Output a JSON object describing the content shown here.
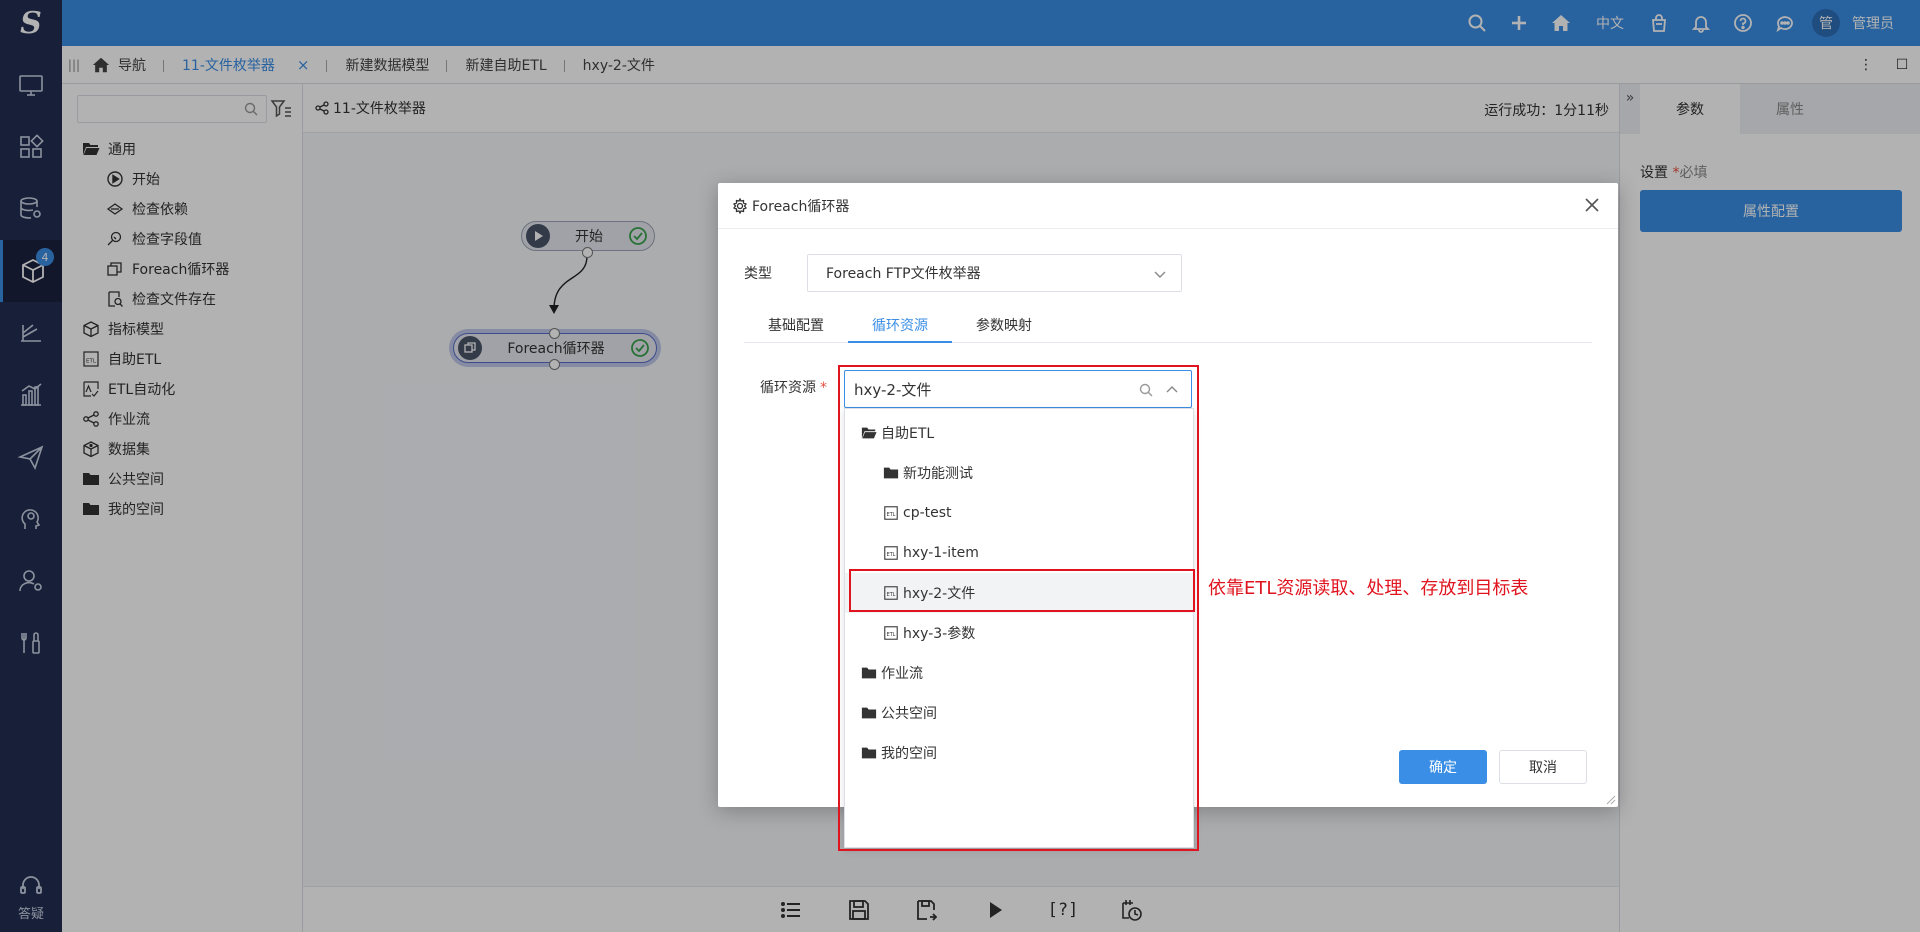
{
  "header": {
    "logo": "S",
    "lang": "中文",
    "avatar": "管",
    "user": "管理员"
  },
  "nav": {
    "badge": "4",
    "help_label": "答疑"
  },
  "tabs": [
    {
      "label": "导航"
    },
    {
      "label": "11-文件枚举器",
      "active": true
    },
    {
      "label": "新建数据模型"
    },
    {
      "label": "新建自助ETL"
    },
    {
      "label": "hxy-2-文件"
    }
  ],
  "tab_close": "×",
  "resource_panel": {
    "search_placeholder": "",
    "tree": [
      {
        "label": "通用",
        "icon": "folder-open-icon",
        "level": 0
      },
      {
        "label": "开始",
        "icon": "play-circle-icon",
        "level": 1
      },
      {
        "label": "检查依赖",
        "icon": "dependency-icon",
        "level": 1
      },
      {
        "label": "检查字段值",
        "icon": "field-check-icon",
        "level": 1
      },
      {
        "label": "Foreach循环器",
        "icon": "loop-icon",
        "level": 1
      },
      {
        "label": "检查文件存在",
        "icon": "file-search-icon",
        "level": 1
      },
      {
        "label": "指标模型",
        "icon": "cube-icon",
        "level": 0
      },
      {
        "label": "自助ETL",
        "icon": "etl-icon",
        "level": 0
      },
      {
        "label": "ETL自动化",
        "icon": "etl-auto-icon",
        "level": 0
      },
      {
        "label": "作业流",
        "icon": "workflow-icon",
        "level": 0
      },
      {
        "label": "数据集",
        "icon": "dataset-icon",
        "level": 0
      },
      {
        "label": "公共空间",
        "icon": "folder-icon",
        "level": 0
      },
      {
        "label": "我的空间",
        "icon": "folder-icon",
        "level": 0
      }
    ]
  },
  "canvas": {
    "flow_name": "11-文件枚举器",
    "run_status": "运行成功：1分11秒",
    "nodes": {
      "start": "开始",
      "foreach": "Foreach循环器"
    },
    "toolbar_help": "[?]"
  },
  "right_panel": {
    "tabs": [
      "参数",
      "属性"
    ],
    "setting_label": "设置",
    "required_mark": "*",
    "required_text": "必填",
    "config_button": "属性配置"
  },
  "dialog": {
    "title": "Foreach循环器",
    "type_label": "类型",
    "type_value": "Foreach FTP文件枚举器",
    "tabs": [
      "基础配置",
      "循环资源",
      "参数映射"
    ],
    "active_tab": "循环资源",
    "field_label": "循环资源",
    "required_mark": "*",
    "ok": "确定",
    "cancel": "取消"
  },
  "dropdown": {
    "value": "hxy-2-文件",
    "items": [
      {
        "label": "自助ETL",
        "icon": "folder-open-icon",
        "level": 0
      },
      {
        "label": "新功能测试",
        "icon": "folder-icon",
        "level": 1
      },
      {
        "label": "cp-test",
        "icon": "etl-icon",
        "level": 1
      },
      {
        "label": "hxy-1-item",
        "icon": "etl-icon",
        "level": 1
      },
      {
        "label": "hxy-2-文件",
        "icon": "etl-icon",
        "level": 1,
        "highlight": true
      },
      {
        "label": "hxy-3-参数",
        "icon": "etl-icon",
        "level": 1
      },
      {
        "label": "作业流",
        "icon": "folder-icon",
        "level": 0
      },
      {
        "label": "公共空间",
        "icon": "folder-icon",
        "level": 0
      },
      {
        "label": "我的空间",
        "icon": "folder-icon",
        "level": 0
      }
    ]
  },
  "annotation": "依靠ETL资源读取、处理、存放到目标表"
}
